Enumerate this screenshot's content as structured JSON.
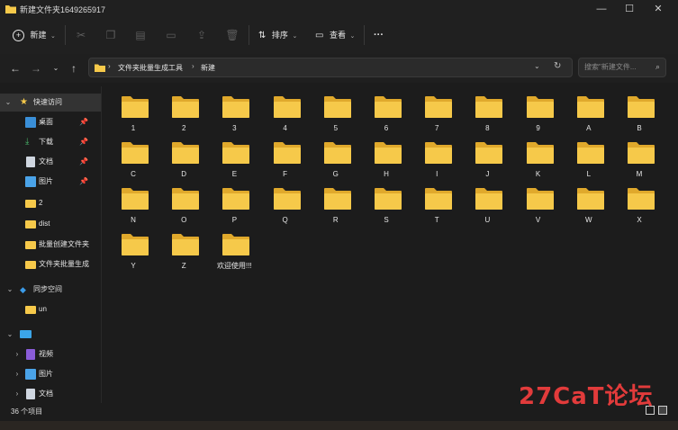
{
  "window": {
    "title": "新建文件夹1649265917"
  },
  "toolbar": {
    "new_label": "新建",
    "sort_label": "排序",
    "view_label": "查看",
    "more_label": "···"
  },
  "address": {
    "path": [
      "文件夹批量生成工具",
      "新建"
    ],
    "search_placeholder": "搜索\"新建文件..."
  },
  "sidebar": {
    "quick_access": "快速访问",
    "items": [
      {
        "label": "桌面",
        "pinned": true
      },
      {
        "label": "下载",
        "pinned": true
      },
      {
        "label": "文档",
        "pinned": true
      },
      {
        "label": "图片",
        "pinned": true
      },
      {
        "label": "2",
        "pinned": false
      },
      {
        "label": "dist",
        "pinned": false
      },
      {
        "label": "批量创建文件夹",
        "pinned": false
      },
      {
        "label": "文件夹批量生成",
        "pinned": false
      }
    ],
    "sync_space": "同步空间",
    "un": "un",
    "pc_items": [
      {
        "label": "视频"
      },
      {
        "label": "图片"
      },
      {
        "label": "文档"
      }
    ]
  },
  "folders": [
    "1",
    "2",
    "3",
    "4",
    "5",
    "6",
    "7",
    "8",
    "9",
    "A",
    "B",
    "C",
    "D",
    "E",
    "F",
    "G",
    "H",
    "I",
    "J",
    "K",
    "L",
    "M",
    "N",
    "O",
    "P",
    "Q",
    "R",
    "S",
    "T",
    "U",
    "V",
    "W",
    "X",
    "Y",
    "Z",
    "欢迎使用!!!"
  ],
  "status": {
    "count": "36 个项目"
  },
  "watermark": "27CaT论坛",
  "colors": {
    "folder": "#f6c94a",
    "folder_back": "#e0a92c",
    "background": "#1c1c1c"
  }
}
